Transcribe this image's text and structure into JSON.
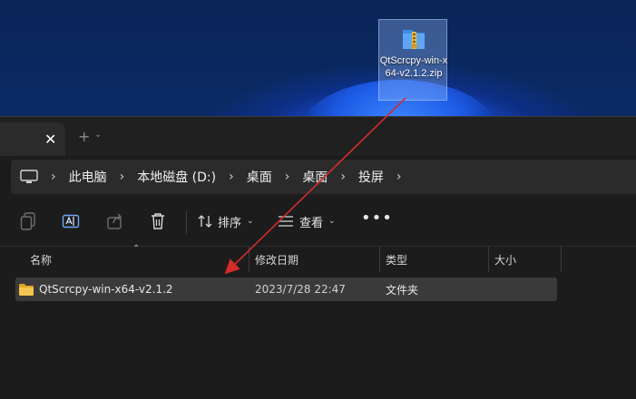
{
  "desktop": {
    "icon_label": "QtScrcpy-win-x64-v2.1.2.zip",
    "icon_name": "zip-archive-icon"
  },
  "tabs": [
    {
      "label": "",
      "close": "✕"
    }
  ],
  "tab_add": "+",
  "tab_dropdown": "⌄",
  "breadcrumb": {
    "root_icon": "computer-icon",
    "items": [
      "此电脑",
      "本地磁盘 (D:)",
      "桌面",
      "桌面",
      "投屏"
    ],
    "separator": "›"
  },
  "toolbar": {
    "sort_label": "排序",
    "view_label": "查看",
    "more": "•••"
  },
  "columns": {
    "name": "名称",
    "modified": "修改日期",
    "type": "类型",
    "size": "大小"
  },
  "files": [
    {
      "name": "QtScrcpy-win-x64-v2.1.2",
      "modified": "2023/7/28 22:47",
      "type": "文件夹",
      "size": "",
      "icon": "folder-icon"
    }
  ],
  "colors": {
    "accent_arrow": "#d62b2b",
    "folder": "#f2c14e",
    "window_bg": "#1c1c1c"
  }
}
